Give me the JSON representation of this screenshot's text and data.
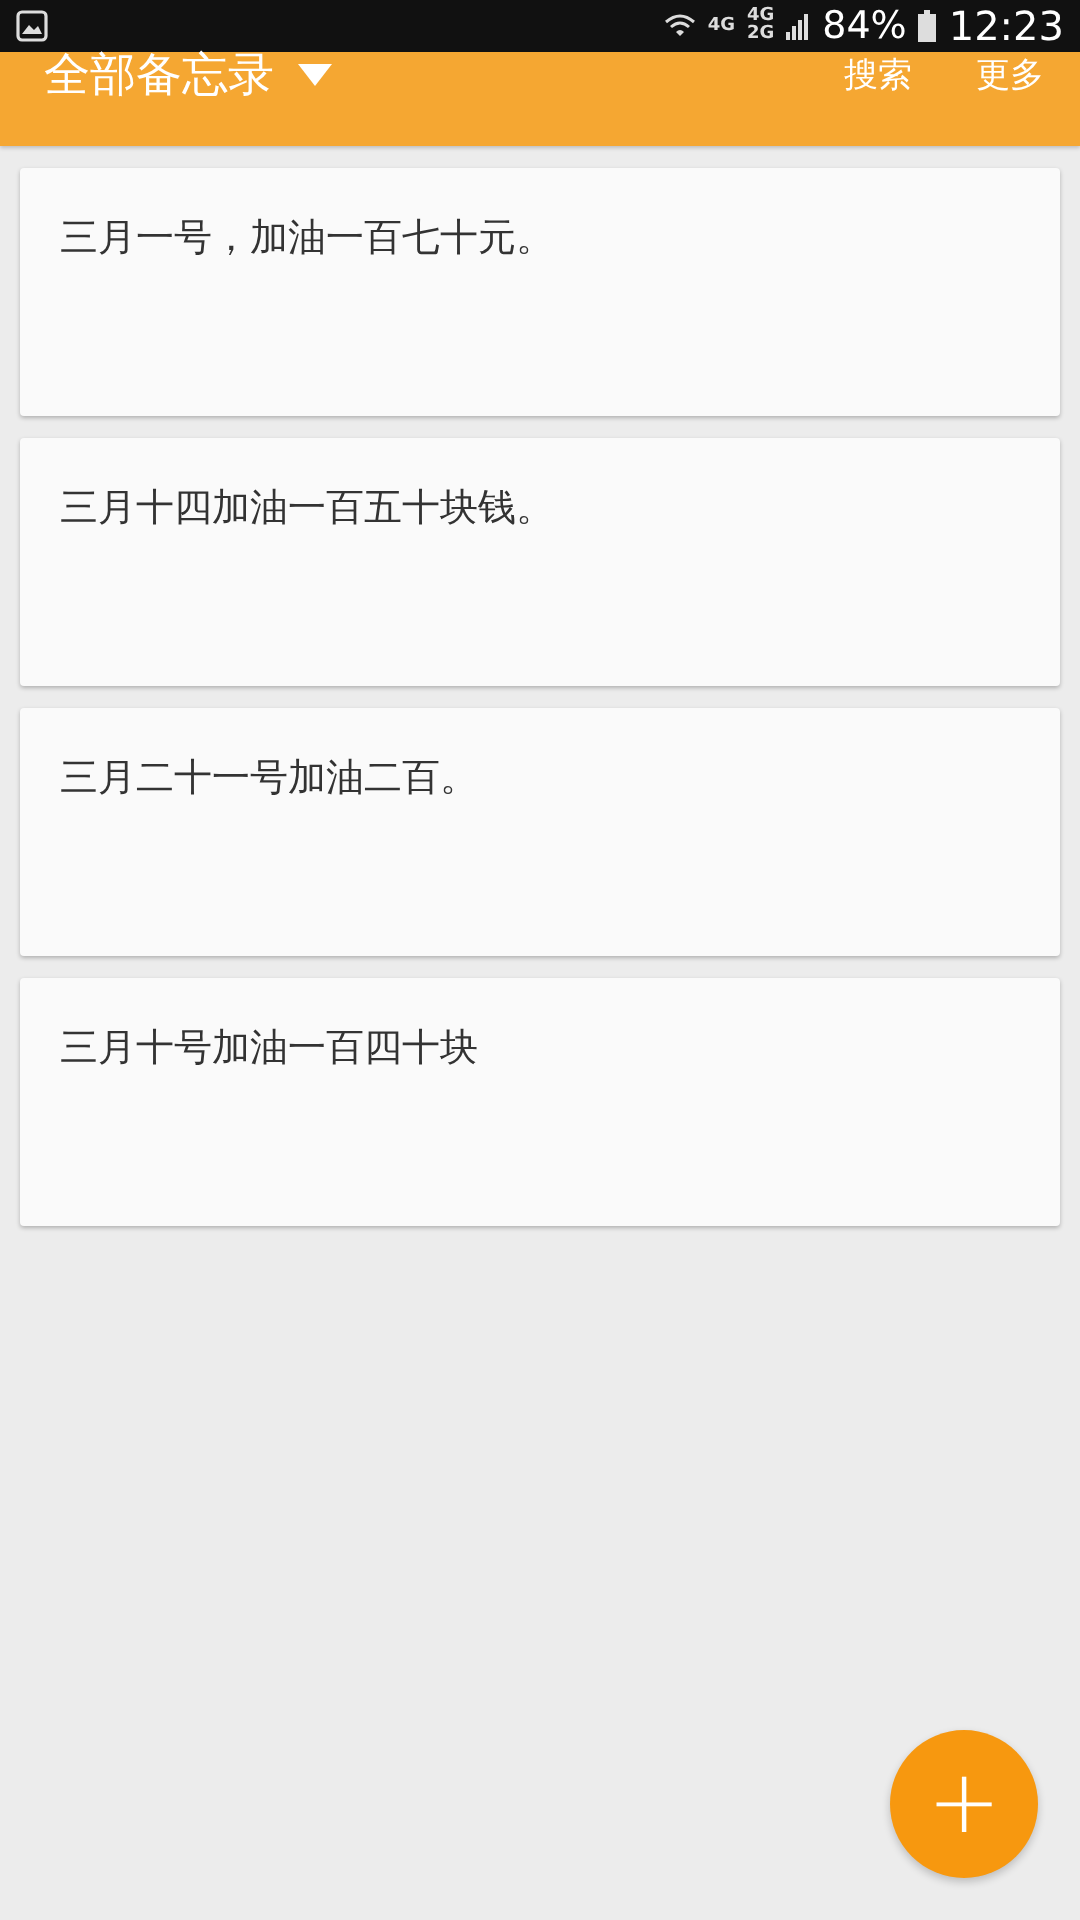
{
  "status_bar": {
    "network_labels": [
      "4G",
      "4G",
      "2G"
    ],
    "battery": "84%",
    "time": "12:23"
  },
  "header": {
    "title": "全部备忘录",
    "actions": [
      "搜索",
      "更多"
    ]
  },
  "notes": [
    {
      "text": "三月一号，加油一百七十元。"
    },
    {
      "text": "三月十四加油一百五十块钱。"
    },
    {
      "text": "三月二十一号加油二百。"
    },
    {
      "text": "三月十号加油一百四十块"
    }
  ],
  "fab": {
    "symbol": "+"
  }
}
